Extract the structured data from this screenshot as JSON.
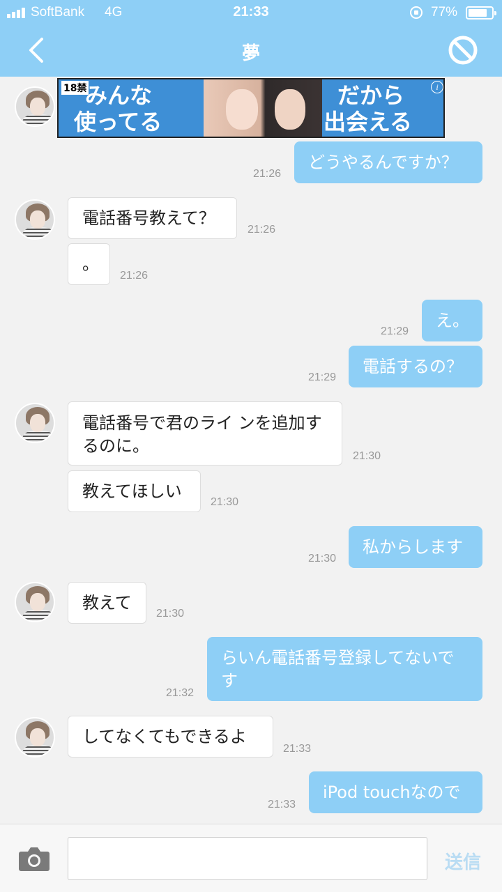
{
  "status_bar": {
    "carrier": "SoftBank",
    "network": "4G",
    "time": "21:33",
    "battery_pct": "77%",
    "battery_level": 0.77
  },
  "header": {
    "title": "夢"
  },
  "ad": {
    "age_label": "18禁",
    "left_line1": "みんな",
    "left_line2": "使ってる",
    "right_line1": "だから",
    "right_line2": "出会える",
    "info": "i"
  },
  "messages": [
    {
      "side": "out",
      "text": "どうやるんですか？",
      "time": "21:26"
    },
    {
      "side": "in",
      "text": "電話番号教えて？",
      "time": "21:26"
    },
    {
      "side": "in",
      "text": "。",
      "time": "21:26"
    },
    {
      "side": "out",
      "text": "え。",
      "time": "21:29"
    },
    {
      "side": "out",
      "text": "電話するの？",
      "time": "21:29"
    },
    {
      "side": "in",
      "text": "電話番号で君のライ ンを追加するのに。",
      "time": "21:30"
    },
    {
      "side": "in",
      "text": "教えてほしい",
      "time": "21:30"
    },
    {
      "side": "out",
      "text": "私からします",
      "time": "21:30"
    },
    {
      "side": "in",
      "text": "教えて",
      "time": "21:30"
    },
    {
      "side": "out",
      "text": "らいん電話番号登録してないです",
      "time": "21:32"
    },
    {
      "side": "in",
      "text": "してなくてもできるよ",
      "time": "21:33"
    },
    {
      "side": "out",
      "text": "iPod touchなので",
      "time": "21:33"
    }
  ],
  "composer": {
    "placeholder": "",
    "send_label": "送信"
  },
  "icons": {
    "back": "chevron-left-icon",
    "block": "block-icon",
    "camera": "camera-icon",
    "signal": "signal-icon",
    "rotation_lock": "rotation-lock-icon",
    "battery": "battery-icon"
  },
  "colors": {
    "accent": "#8ecff6",
    "background": "#f2f2f2",
    "send_disabled": "#b9dcf3"
  }
}
